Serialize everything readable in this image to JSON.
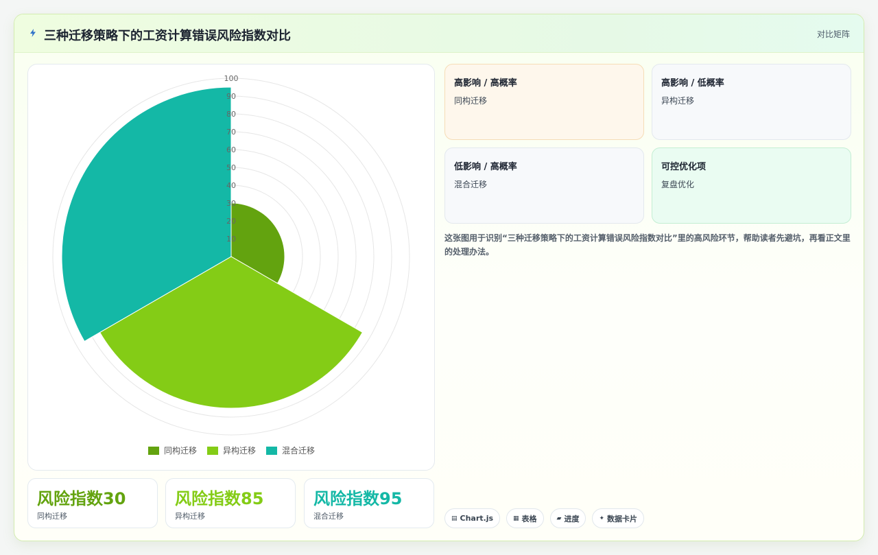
{
  "header": {
    "title": "三种迁移策略下的工资计算错误风险指数对比",
    "badge": "对比矩阵",
    "icon": "lightning-icon",
    "accent": "#2f72c9"
  },
  "chart_data": {
    "type": "polarArea",
    "categories": [
      "同构迁移",
      "异构迁移",
      "混合迁移"
    ],
    "values": [
      30,
      85,
      95
    ],
    "colors": [
      "#63a30f",
      "#84cc16",
      "#14b8a6"
    ],
    "rlim": [
      0,
      100
    ],
    "ticks": [
      10,
      20,
      30,
      40,
      50,
      60,
      70,
      80,
      90,
      100
    ],
    "grid": true,
    "legend": "bottom"
  },
  "stats": [
    {
      "value": "风险指数30",
      "label": "同构迁移",
      "color": "#63a30f"
    },
    {
      "value": "风险指数85",
      "label": "异构迁移",
      "color": "#84cc16"
    },
    {
      "value": "风险指数95",
      "label": "混合迁移",
      "color": "#14b8a6"
    }
  ],
  "matrix": [
    {
      "title": "高影响 / 高概率",
      "item": "同构迁移"
    },
    {
      "title": "高影响 / 低概率",
      "item": "异构迁移"
    },
    {
      "title": "低影响 / 高概率",
      "item": "混合迁移"
    },
    {
      "title": "可控优化项",
      "item": "复盘优化"
    }
  ],
  "description": "这张图用于识别“三种迁移策略下的工资计算错误风险指数对比”里的高风险环节，帮助读者先避坑，再看正文里的处理办法。",
  "tags": [
    {
      "icon": "chart-icon",
      "glyph": "▤",
      "label": "Chart.js"
    },
    {
      "icon": "table-icon",
      "glyph": "▦",
      "label": "表格"
    },
    {
      "icon": "progress-icon",
      "glyph": "▰",
      "label": "进度"
    },
    {
      "icon": "card-icon",
      "glyph": "✦",
      "label": "数据卡片"
    }
  ]
}
